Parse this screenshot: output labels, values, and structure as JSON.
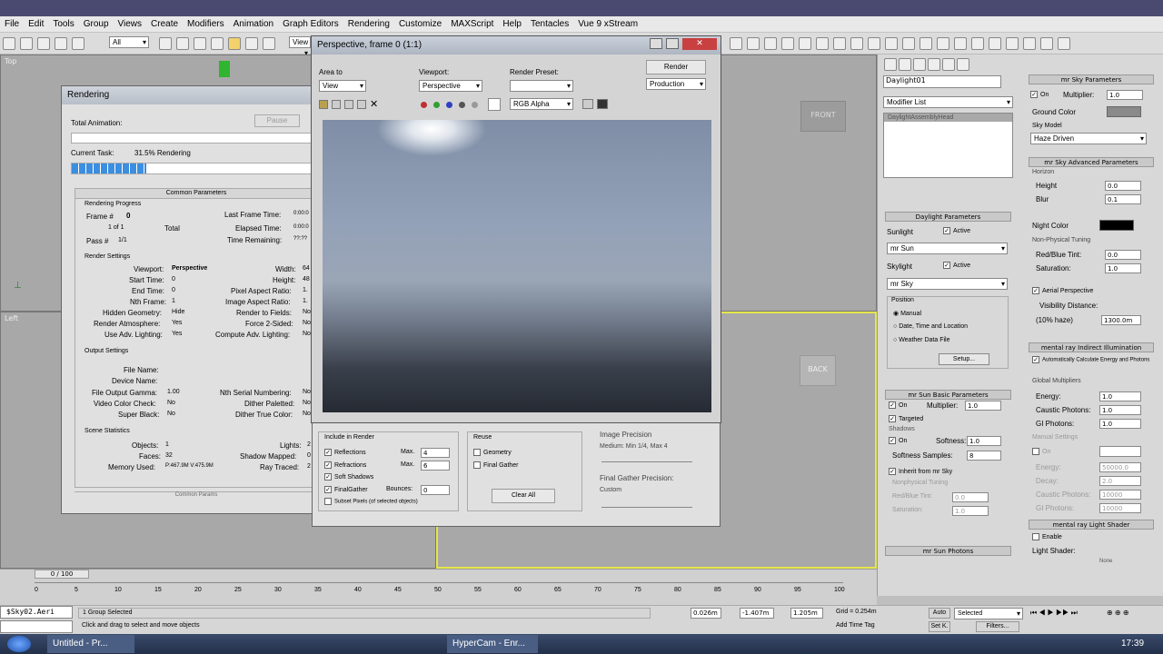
{
  "menu": [
    "File",
    "Edit",
    "Tools",
    "Group",
    "Views",
    "Create",
    "Modifiers",
    "Animation",
    "Graph Editors",
    "Rendering",
    "Customize",
    "MAXScript",
    "Help",
    "Tentacles",
    "Vue 9 xStream"
  ],
  "toolbar": {
    "selection_filter": "All",
    "view_label": "View"
  },
  "viewports": {
    "top_label": "Top",
    "front_label": "FRONT",
    "left_label": "Left",
    "back_label": "BACK"
  },
  "rendering_dialog": {
    "title": "Rendering",
    "total_animation": "Total Animation:",
    "pause": "Pause",
    "current_task_label": "Current Task:",
    "current_task_value": "31.5% Rendering",
    "progress_fraction": 0.31,
    "common_parameters": "Common Parameters",
    "rendering_progress": "Rendering Progress",
    "frame_label": "Frame #",
    "frame_value": "0",
    "of_label": "1  of  1",
    "total": "Total",
    "pass_label": "Pass #",
    "pass_value": "1/1",
    "last_frame_time": "Last Frame Time:",
    "last_frame_time_value": "0:00:0",
    "elapsed_time": "Elapsed Time:",
    "elapsed_time_value": "0:00:0",
    "time_remaining": "Time Remaining:",
    "time_remaining_value": "??:??",
    "render_settings": "Render Settings",
    "viewport_label": "Viewport:",
    "viewport_value": "Perspective",
    "start_time": "Start Time:",
    "start_time_value": "0",
    "end_time": "End Time:",
    "end_time_value": "0",
    "nth_frame": "Nth Frame:",
    "nth_frame_value": "1",
    "hidden_geometry": "Hidden Geometry:",
    "hidden_geometry_value": "Hide",
    "render_atmosphere": "Render Atmosphere:",
    "render_atmosphere_value": "Yes",
    "use_adv_lighting": "Use Adv. Lighting:",
    "use_adv_lighting_value": "Yes",
    "width": "Width:",
    "width_value": "64",
    "height": "Height:",
    "height_value": "48",
    "pixel_aspect": "Pixel Aspect Ratio:",
    "pixel_aspect_value": "1.",
    "image_aspect": "Image Aspect Ratio:",
    "image_aspect_value": "1.",
    "render_to_fields": "Render to Fields:",
    "render_to_fields_value": "No",
    "force_2sided": "Force 2-Sided:",
    "force_2sided_value": "No",
    "compute_adv_lighting": "Compute Adv. Lighting:",
    "compute_adv_lighting_value": "No",
    "output_settings": "Output Settings",
    "file_name": "File Name:",
    "device_name": "Device Name:",
    "file_output_gamma": "File Output Gamma:",
    "file_output_gamma_value": "1.00",
    "video_color_check": "Video Color Check:",
    "video_color_check_value": "No",
    "super_black": "Super Black:",
    "super_black_value": "No",
    "nth_serial": "Nth Serial Numbering:",
    "nth_serial_value": "No",
    "dither_paletted": "Dither Paletted:",
    "dither_paletted_value": "No",
    "dither_true_color": "Dither True Color:",
    "dither_true_color_value": "No",
    "scene_statistics": "Scene Statistics",
    "objects": "Objects:",
    "objects_value": "1",
    "faces": "Faces:",
    "faces_value": "32",
    "memory_used": "Memory Used:",
    "memory_used_value": "P:467.9M V:475.9M",
    "lights": "Lights:",
    "lights_value": "2",
    "shadow_mapped": "Shadow Mapped:",
    "shadow_mapped_value": "0",
    "rays_traced": "Ray Traced:",
    "rays_traced_value": "2",
    "bottom_collapsed": "Common Params"
  },
  "frame_window": {
    "title": "Perspective, frame 0 (1:1)",
    "area_to": "Area to",
    "area_value": "View",
    "viewport_label": "Viewport:",
    "viewport_value": "Perspective",
    "render_preset": "Render Preset:",
    "render_preset_value": "",
    "render_button": "Render",
    "production": "Production",
    "channel": "RGB Alpha"
  },
  "render_setup_bottom": {
    "include_in_render": "Include in Render",
    "reflections": "Reflections",
    "refractions": "Refractions",
    "max_label": "Max.",
    "max_reflections": "4",
    "max_refractions": "6",
    "soft_shadows": "Soft Shadows",
    "final_gather": "FinalGather",
    "bounces": "Bounces:",
    "bounces_value": "0",
    "subset_pixels": "Subset Pixels (of selected objects)",
    "reuse": "Reuse",
    "geometry": "Geometry",
    "final_gather_reuse": "Final Gather",
    "clear_all": "Clear All",
    "image_precision": "Image Precision",
    "image_precision_value": "Medium: Min 1/4, Max 4",
    "fg_precision": "Final Gather Precision:",
    "fg_precision_value": "Custom"
  },
  "command_panel": {
    "object_name": "Daylight01",
    "modifier_list": "Modifier List",
    "stack_item": "DaylightAssemblyHead",
    "daylight_parameters": "Daylight Parameters",
    "sunlight": "Sunlight",
    "active": "Active",
    "sun_type": "mr Sun",
    "skylight": "Skylight",
    "sky_type": "mr Sky",
    "position": "Position",
    "manual": "Manual",
    "date_time": "Date, Time and Location",
    "weather": "Weather Data File",
    "setup": "Setup...",
    "mr_sun_basic": "mr Sun Basic Parameters",
    "on": "On",
    "multiplier": "Multiplier:",
    "multiplier_value": "1.0",
    "targeted": "Targeted",
    "shadows": "Shadows",
    "softness": "Softness:",
    "softness_value": "1.0",
    "softness_samples": "Softness Samples:",
    "softness_samples_value": "8",
    "inherit": "Inherit from mr Sky",
    "nonphysical": "Nonphysical Tuning",
    "red_blue_tint": "Red/Blue Tint:",
    "red_blue_value": "0.0",
    "saturation": "Saturation:",
    "saturation_value": "1.0",
    "mr_sun_photons": "mr Sun Photons"
  },
  "sky_panel": {
    "sky_parameters": "mr Sky Parameters",
    "on": "On",
    "multiplier": "Multiplier:",
    "multiplier_value": "1.0",
    "ground_color": "Ground Color",
    "ground_color_hex": "#8a8a8a",
    "sky_model": "Sky Model",
    "sky_model_value": "Haze Driven",
    "advanced": "mr Sky Advanced Parameters",
    "horizon": "Horizon",
    "height": "Height",
    "height_value": "0.0",
    "blur": "Blur",
    "blur_value": "0.1",
    "night_color": "Night Color",
    "night_color_hex": "#000000",
    "nonphysical": "Non-Physical Tuning",
    "red_blue_tint": "Red/Blue Tint:",
    "red_blue_value": "0.0",
    "saturation": "Saturation:",
    "saturation_value": "1.0",
    "aerial": "Aerial Perspective",
    "visibility": "Visibility Distance:",
    "haze_label": "(10% haze)",
    "haze_value": "1300.0m",
    "indirect": "mental ray Indirect Illumination",
    "auto_calc": "Automatically Calculate Energy and Photons",
    "global_multipliers": "Global Multipliers",
    "energy": "Energy:",
    "energy_value": "1.0",
    "caustic_photons": "Caustic Photons:",
    "caustic_value": "1.0",
    "gi_photons": "GI Photons:",
    "gi_value": "1.0",
    "manual_settings": "Manual Settings",
    "on2": "On",
    "energy2_value": "50000.0",
    "decay": "Decay:",
    "decay_value": "2.0",
    "caustic2_value": "10000",
    "gi2_value": "10000",
    "light_shader": "mental ray Light Shader",
    "enable": "Enable",
    "light_shader_label": "Light Shader:",
    "light_shader_value": "None"
  },
  "timeline": {
    "frame_counter": "0 / 100",
    "ticks": [
      "0",
      "5",
      "10",
      "15",
      "20",
      "25",
      "30",
      "35",
      "40",
      "45",
      "50",
      "55",
      "60",
      "65",
      "70",
      "75",
      "80",
      "85",
      "90",
      "95",
      "100"
    ]
  },
  "status": {
    "script_label": "$Sky02.Aeri",
    "selection": "1 Group Selected",
    "prompt": "Click and drag to select and move objects",
    "x": "0.026m",
    "y": "-1.407m",
    "z": "1.205m",
    "grid": "Grid = 0.254m",
    "add_time_tag": "Add Time Tag",
    "auto": "Auto",
    "selected": "Selected",
    "set_k": "Set K.",
    "filters": "Filters..."
  },
  "taskbar": {
    "item1": "Untitled - Pr...",
    "item2": "HyperCam - Enr...",
    "clock": "17:39"
  }
}
